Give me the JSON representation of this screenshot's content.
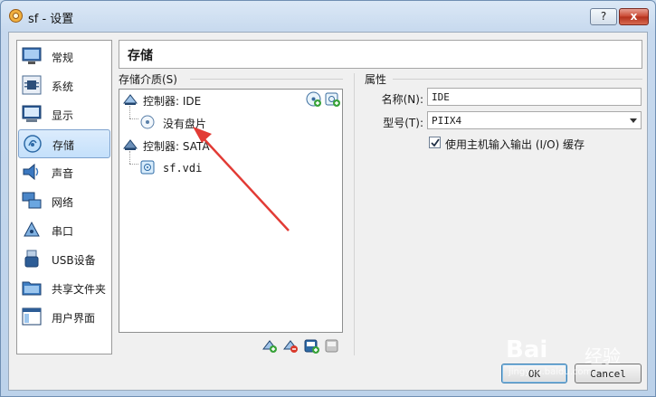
{
  "window": {
    "title": "sf - 设置",
    "help_label": "?",
    "close_label": "x"
  },
  "nav": {
    "items": [
      {
        "label": "常规",
        "icon": "monitor-icon"
      },
      {
        "label": "系统",
        "icon": "chip-icon"
      },
      {
        "label": "显示",
        "icon": "display-icon"
      },
      {
        "label": "存储",
        "icon": "disk-icon",
        "selected": true
      },
      {
        "label": "声音",
        "icon": "speaker-icon"
      },
      {
        "label": "网络",
        "icon": "network-icon"
      },
      {
        "label": "串口",
        "icon": "serial-port-icon"
      },
      {
        "label": "USB设备",
        "icon": "usb-icon"
      },
      {
        "label": "共享文件夹",
        "icon": "folder-icon"
      },
      {
        "label": "用户界面",
        "icon": "window-icon"
      }
    ]
  },
  "page": {
    "title": "存储"
  },
  "storage": {
    "group_label": "存储介质(S)",
    "tree": [
      {
        "label": "控制器: IDE",
        "kind": "controller"
      },
      {
        "label": "没有盘片",
        "kind": "optical"
      },
      {
        "label": "控制器: SATA",
        "kind": "controller"
      },
      {
        "label": "sf.vdi",
        "kind": "harddisk"
      }
    ]
  },
  "attributes": {
    "group_label": "属性",
    "name_label": "名称(N):",
    "name_value": "IDE",
    "type_label": "型号(T):",
    "type_value": "PIIX4",
    "host_io_label": "使用主机输入输出 (I/O) 缓存",
    "host_io_checked": true
  },
  "buttons": {
    "ok": "OK",
    "cancel": "Cancel"
  },
  "watermark": {
    "brand": "Bai",
    "suffix": "经验",
    "url": "jingyan.baidu.com"
  },
  "colors": {
    "annotation_arrow": "#e23b35",
    "selection": "#c4e0fb"
  }
}
